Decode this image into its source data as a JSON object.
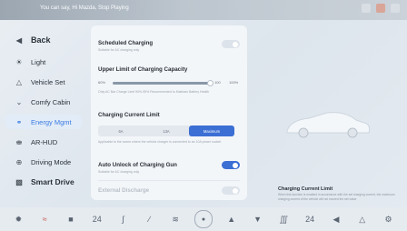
{
  "status_bar": {
    "hint": "You can say, Hi Mazda, Stop Playing"
  },
  "sidebar": {
    "back_label": "Back",
    "items": [
      {
        "label": "Light",
        "icon": "sun-icon"
      },
      {
        "label": "Vehicle Set",
        "icon": "car-outline-icon"
      },
      {
        "label": "Comfy Cabin",
        "icon": "chevron-down-icon"
      },
      {
        "label": "Energy Mgmt",
        "icon": "energy-icon",
        "active": true
      },
      {
        "label": "AR-HUD",
        "icon": "hud-icon"
      },
      {
        "label": "Driving Mode",
        "icon": "steering-icon"
      },
      {
        "label": "Smart Drive",
        "icon": "smart-drive-icon"
      }
    ]
  },
  "main": {
    "scheduled": {
      "title": "Scheduled Charging",
      "sub": "Suitable for AC charging only",
      "on": false
    },
    "upper_limit": {
      "title": "Upper Limit of Charging Capacity",
      "min": "60%",
      "value_label": "100",
      "max": "100%",
      "value": 100,
      "sub": "Only AC Bar Charge Limit 90%-95% Recommended to Maintain Battery Health"
    },
    "current_limit": {
      "title": "Charging Current Limit",
      "options": [
        "6A",
        "13A",
        "Maximum"
      ],
      "selected": "Maximum",
      "sub": "Applicable to the scene where the vehicle charger is connected to an 10A power socket"
    },
    "auto_unlock": {
      "title": "Auto Unlock of Charging Gun",
      "sub": "Suitable for AC charging only",
      "on": true
    },
    "external": {
      "title": "External Discharge",
      "on": false
    }
  },
  "right_panel": {
    "title": "Charging Current Limit",
    "sub": "When this function is enabled in accordance with the set charging current, the maximum charging current of the vehicle will not exceed the set value"
  },
  "dock": {
    "items": [
      "fan-icon",
      "defrost-front-icon",
      "seat-heat-icon",
      "temp-left-icon",
      "seat-vent-icon",
      "ac-icon",
      "airflow-icon",
      "home-icon",
      "rear-defrost-icon",
      "windshield-icon",
      "seat-heat-right-icon",
      "temp-right-icon",
      "volume-icon",
      "steering-heat-icon",
      "settings-icon"
    ],
    "temp_left": "24",
    "temp_right": "24"
  },
  "colors": {
    "accent": "#3b6fd4",
    "active_text": "#3a7be0"
  }
}
